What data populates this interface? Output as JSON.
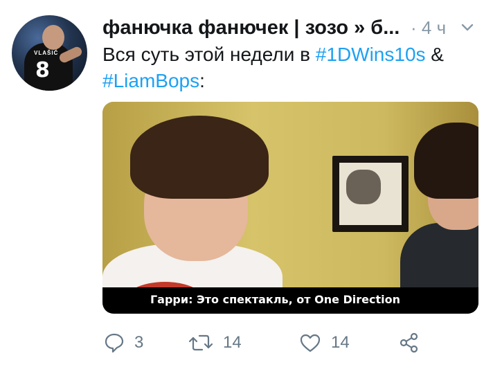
{
  "tweet": {
    "display_name": "фанючка фанючек | зозо » б...",
    "time": "· 4 ч",
    "text_before": "Вся суть этой недели в ",
    "hashtag1": "#1DWins10s",
    "text_mid": " &",
    "hashtag2": "#LiamBops",
    "text_after": ":",
    "avatar_jersey_name": "VLAŠIĆ",
    "avatar_jersey_number": "8"
  },
  "media": {
    "caption": "Гарри: Это спектакль, от One Direction"
  },
  "actions": {
    "reply_count": "3",
    "retweet_count": "14",
    "like_count": "14"
  },
  "colors": {
    "accent": "#1da1f2",
    "text": "#14171a",
    "muted": "#657786"
  }
}
